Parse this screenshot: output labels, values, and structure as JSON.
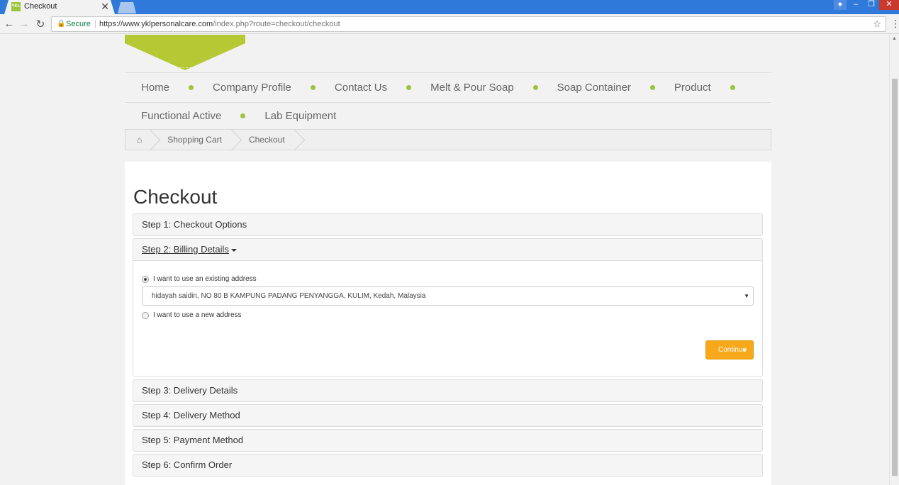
{
  "browser": {
    "tab_title": "Checkout",
    "favicon_text": "YKL",
    "tab_close": "✕",
    "secure_label": "Secure",
    "url_host": "https://www.yklpersonalcare.com",
    "url_path": "/index.php?route=checkout/checkout",
    "icons": {
      "back": "back-arrow-icon",
      "forward": "forward-arrow-icon",
      "reload": "reload-icon",
      "lock": "lock-icon",
      "star": "bookmark-star-icon",
      "menu": "more-vert-icon"
    }
  },
  "nav": {
    "row1": [
      "Home",
      "Company Profile",
      "Contact Us",
      "Melt & Pour Soap",
      "Soap Container",
      "Product"
    ],
    "row2": [
      "Functional Active",
      "Lab Equipment"
    ],
    "dot_color": "#9bc43a"
  },
  "breadcrumb": {
    "home_icon": "home-icon",
    "items": [
      "Shopping Cart",
      "Checkout"
    ]
  },
  "checkout": {
    "title": "Checkout",
    "step1": "Step 1: Checkout Options",
    "step2": "Step 2: Billing Details",
    "step3": "Step 3: Delivery Details",
    "step4": "Step 4: Delivery Method",
    "step5": "Step 5: Payment Method",
    "step6": "Step 6: Confirm Order",
    "billing": {
      "existing_label": "I want to use an existing address",
      "selected_address": "hidayah saidin, NO 80 B KAMPUNG PADANG PENYANGGA, KULIM, Kedah, Malaysia",
      "new_label": "I want to use a new address",
      "selected_option": "existing"
    },
    "continue_label": "Continue",
    "accent_color": "#f7a81b"
  }
}
